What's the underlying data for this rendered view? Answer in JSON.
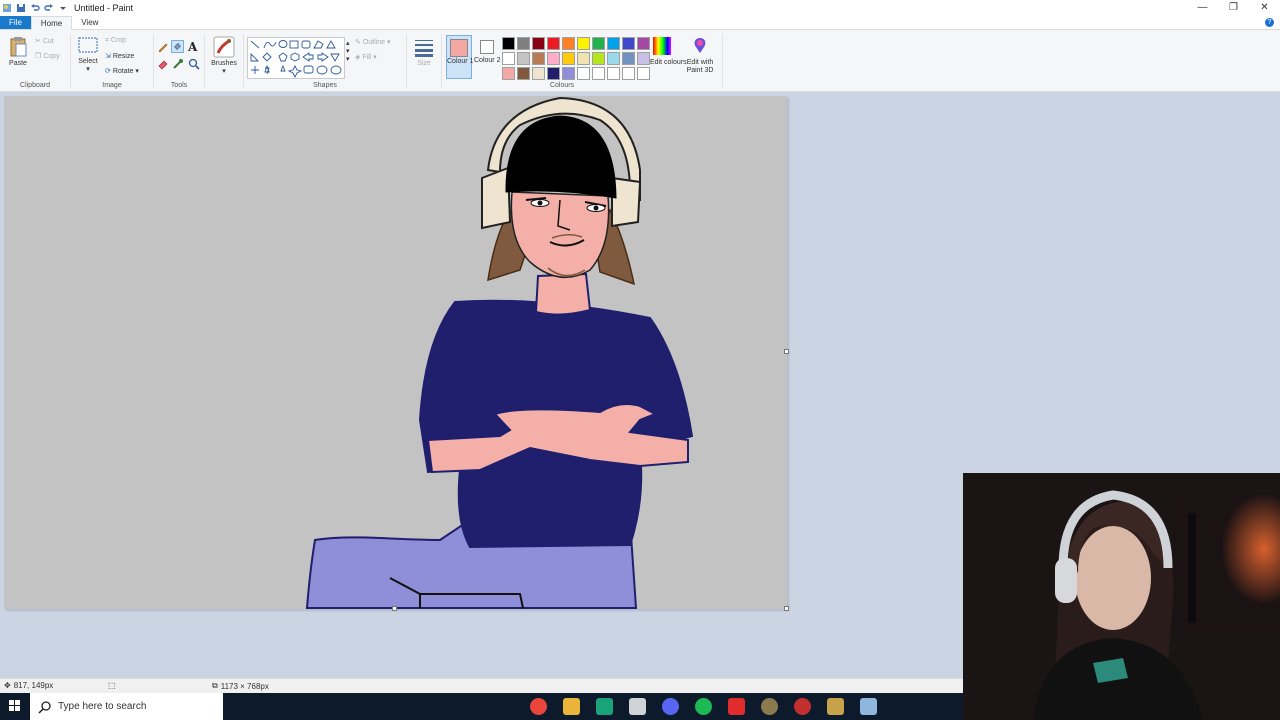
{
  "titlebar": {
    "title": "Untitled - Paint",
    "minimize_glyph": "—",
    "restore_glyph": "❐",
    "close_glyph": "✕"
  },
  "tabs": [
    {
      "label": "File"
    },
    {
      "label": "Home"
    },
    {
      "label": "View"
    }
  ],
  "help_glyph": "?",
  "ribbon": {
    "clipboard": {
      "paste": "Paste",
      "cut": "Cut",
      "copy": "Copy",
      "label": "Clipboard"
    },
    "image": {
      "select": "Select",
      "crop": "Crop",
      "resize": "Resize",
      "rotate": "Rotate",
      "label": "Image"
    },
    "tools": {
      "label": "Tools",
      "text_glyph": "A"
    },
    "brushes": {
      "label": "Brushes"
    },
    "shapes": {
      "outline": "Outline",
      "fill": "Fill",
      "label": "Shapes"
    },
    "size": {
      "label": "Size"
    },
    "colours": {
      "colour1": "Colour 1",
      "colour2": "Colour 2",
      "edit": "Edit colours",
      "paint3d": "Edit with Paint 3D",
      "label": "Colours",
      "colour1_value": "#f4a8a3",
      "colour2_value": "#ffffff",
      "swatches": [
        "#000000",
        "#7f7f7f",
        "#880015",
        "#ed1c24",
        "#ff7f27",
        "#fff200",
        "#22b14c",
        "#00a2e8",
        "#3f48cc",
        "#a349a4",
        "#ffffff",
        "#c3c3c3",
        "#b97a57",
        "#ffaec9",
        "#ffc90e",
        "#efe4b0",
        "#b5e61d",
        "#99d9ea",
        "#7092be",
        "#c8bfe7",
        "#f4a8a3",
        "#7f5a3f",
        "#efe4cf",
        "#1f1f6e",
        "#8e8ed9",
        "#ffffff",
        "#ffffff",
        "#ffffff",
        "#ffffff",
        "#ffffff"
      ]
    }
  },
  "statusbar": {
    "cursor_pos": "817, 149px",
    "canvas_size": "1173 × 768px"
  },
  "taskbar": {
    "search_placeholder": "Type here to search",
    "apps": [
      {
        "name": "chrome",
        "color": "#e9453a"
      },
      {
        "name": "file-explorer",
        "color": "#e8b53a"
      },
      {
        "name": "app-green",
        "color": "#1aa37a"
      },
      {
        "name": "rocket-league",
        "color": "#cfd3d8"
      },
      {
        "name": "discord",
        "color": "#5865f2"
      },
      {
        "name": "spotify",
        "color": "#1db954"
      },
      {
        "name": "app-red-bolt",
        "color": "#e02c2c"
      },
      {
        "name": "app-round",
        "color": "#8a7a4e"
      },
      {
        "name": "app-red-round",
        "color": "#c22f2f"
      },
      {
        "name": "league-of-legends",
        "color": "#c8a24a"
      },
      {
        "name": "paint",
        "color": "#8fb7de"
      }
    ]
  }
}
